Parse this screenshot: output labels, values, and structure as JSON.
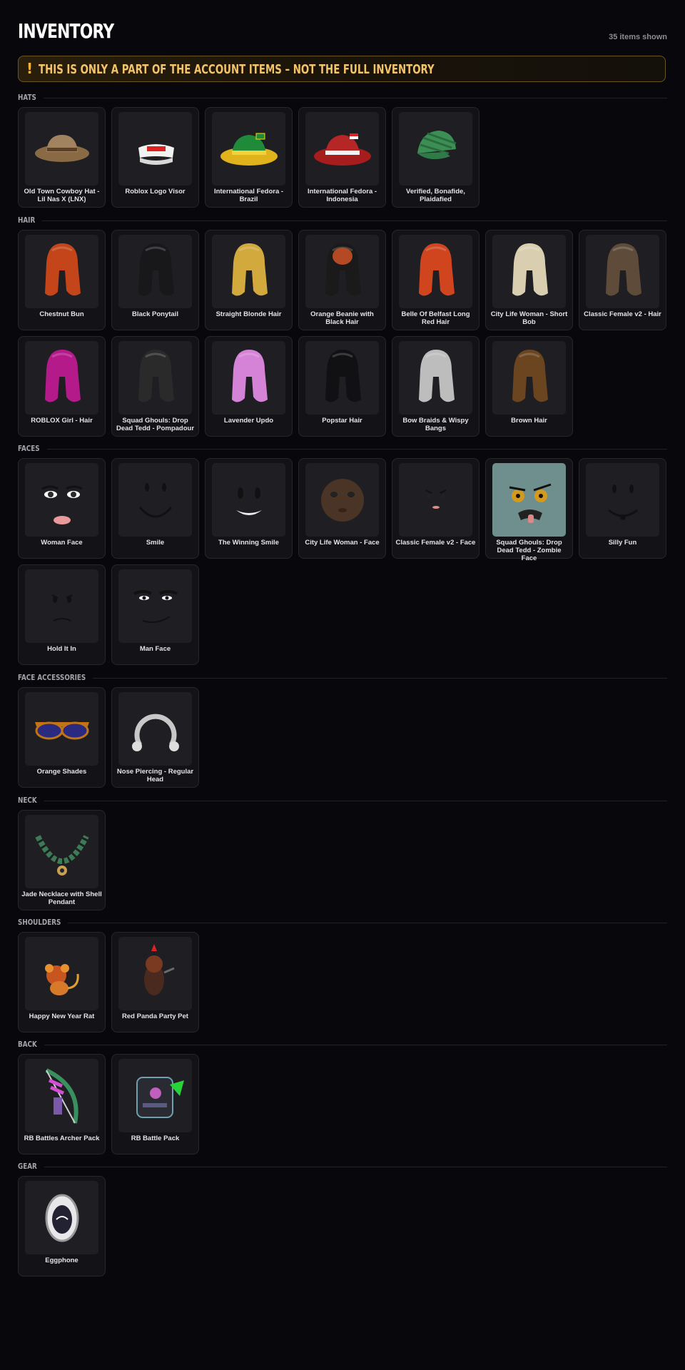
{
  "header": {
    "title": "INVENTORY",
    "count": "35 items shown"
  },
  "banner": {
    "icon": "!",
    "text": "THIS IS ONLY A PART OF THE ACCOUNT ITEMS – NOT THE FULL INVENTORY"
  },
  "sections": [
    {
      "label": "HATS",
      "items": [
        {
          "name": "Old Town Cowboy Hat - Lil Nas X (LNX)",
          "icon": "cowboy-hat-icon"
        },
        {
          "name": "Roblox Logo Visor",
          "icon": "visor-icon"
        },
        {
          "name": "International Fedora - Brazil",
          "icon": "fedora-brazil-icon"
        },
        {
          "name": "International Fedora - Indonesia",
          "icon": "fedora-indonesia-icon"
        },
        {
          "name": "Verified, Bonafide, Plaidafied",
          "icon": "plaid-cap-icon"
        }
      ]
    },
    {
      "label": "HAIR",
      "items": [
        {
          "name": "Chestnut Bun",
          "icon": "hair-icon"
        },
        {
          "name": "Black Ponytail",
          "icon": "hair-icon"
        },
        {
          "name": "Straight Blonde Hair",
          "icon": "hair-icon"
        },
        {
          "name": "Orange Beanie with Black Hair",
          "icon": "beanie-hair-icon"
        },
        {
          "name": "Belle Of Belfast Long Red Hair",
          "icon": "hair-icon"
        },
        {
          "name": "City Life Woman - Short Bob",
          "icon": "hair-icon"
        },
        {
          "name": "Classic Female v2 - Hair",
          "icon": "hair-icon"
        },
        {
          "name": "ROBLOX Girl - Hair",
          "icon": "hair-icon"
        },
        {
          "name": "Squad Ghouls: Drop Dead Tedd - Pompadour",
          "icon": "hair-icon"
        },
        {
          "name": "Lavender Updo",
          "icon": "hair-icon"
        },
        {
          "name": "Popstar Hair",
          "icon": "hair-icon"
        },
        {
          "name": "Bow Braids & Wispy Bangs",
          "icon": "hair-icon"
        },
        {
          "name": "Brown Hair",
          "icon": "hair-icon"
        }
      ]
    },
    {
      "label": "FACES",
      "items": [
        {
          "name": "Woman Face",
          "icon": "face-icon"
        },
        {
          "name": "Smile",
          "icon": "face-icon"
        },
        {
          "name": "The Winning Smile",
          "icon": "face-icon"
        },
        {
          "name": "City Life Woman - Face",
          "icon": "face-icon"
        },
        {
          "name": "Classic Female v2 - Face",
          "icon": "face-icon"
        },
        {
          "name": "Squad Ghouls: Drop Dead Tedd - Zombie Face",
          "icon": "zombie-face-icon"
        },
        {
          "name": "Silly Fun",
          "icon": "face-icon"
        },
        {
          "name": "Hold It In",
          "icon": "face-icon"
        },
        {
          "name": "Man Face",
          "icon": "face-icon"
        }
      ]
    },
    {
      "label": "FACE ACCESSORIES",
      "items": [
        {
          "name": "Orange Shades",
          "icon": "sunglasses-icon"
        },
        {
          "name": "Nose Piercing - Regular Head",
          "icon": "piercing-icon"
        }
      ]
    },
    {
      "label": "NECK",
      "items": [
        {
          "name": "Jade Necklace with Shell Pendant",
          "icon": "necklace-icon"
        }
      ]
    },
    {
      "label": "SHOULDERS",
      "items": [
        {
          "name": "Happy New Year Rat",
          "icon": "rat-pet-icon"
        },
        {
          "name": "Red Panda Party Pet",
          "icon": "red-panda-pet-icon"
        }
      ]
    },
    {
      "label": "BACK",
      "items": [
        {
          "name": "RB Battles Archer Pack",
          "icon": "bow-pack-icon"
        },
        {
          "name": "RB Battle Pack",
          "icon": "battle-pack-icon"
        }
      ]
    },
    {
      "label": "GEAR",
      "items": [
        {
          "name": "Eggphone",
          "icon": "eggphone-icon"
        }
      ]
    }
  ],
  "colors": {
    "background": "#08080c",
    "card": "#121217",
    "accent": "#f3c36a",
    "banner_border": "#6a5420"
  }
}
